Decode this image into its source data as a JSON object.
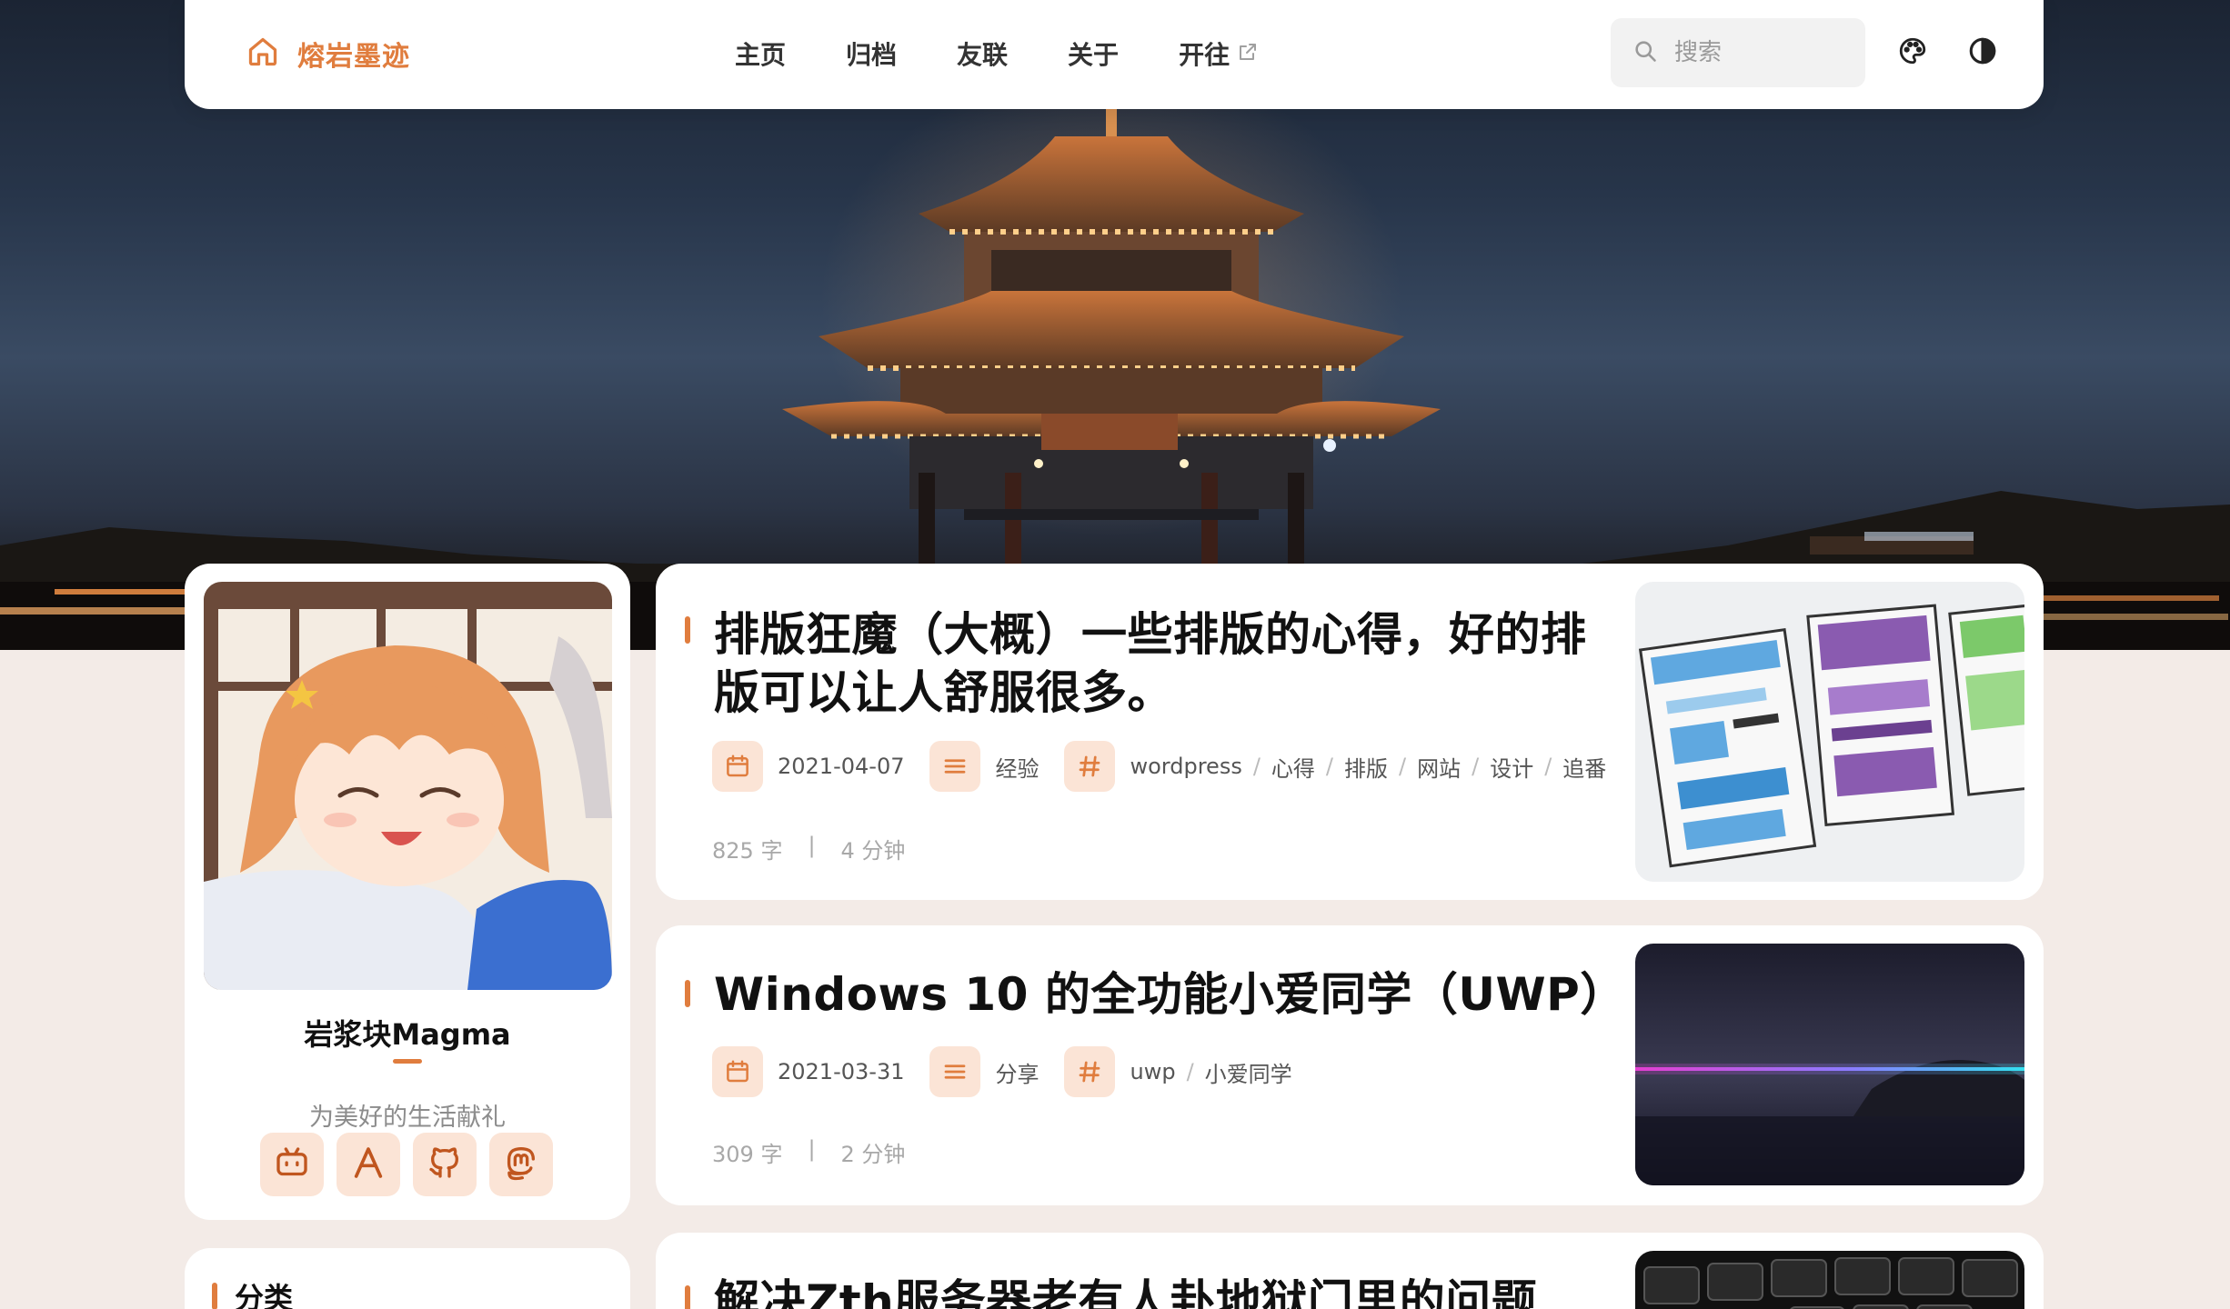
{
  "colors": {
    "accent": "#e07d3e",
    "accent_soft": "#fbe4d6",
    "page_bg": "#f3ebe7"
  },
  "brand": {
    "name": "熔岩墨迹",
    "icon": "home-icon"
  },
  "nav": {
    "items": [
      {
        "label": "主页"
      },
      {
        "label": "归档"
      },
      {
        "label": "友联"
      },
      {
        "label": "关于"
      },
      {
        "label": "开往",
        "icon": "external-link-icon"
      }
    ]
  },
  "search": {
    "placeholder": "搜索",
    "value": ""
  },
  "toolbar": {
    "theme_icon": "palette-icon",
    "mode_icon": "contrast-icon"
  },
  "profile": {
    "name": "岩浆块Magma",
    "motto": "为美好的生活献礼",
    "socials": [
      {
        "icon": "bilibili-icon"
      },
      {
        "icon": "letter-a-icon"
      },
      {
        "icon": "github-icon"
      },
      {
        "icon": "mastodon-icon"
      }
    ]
  },
  "sidebar": {
    "category_title": "分类"
  },
  "posts": [
    {
      "title_line1": "排版狂魔（大概）一些排版的心得，好的排",
      "title_line2": "版可以让人舒服很多。",
      "date": "2021-04-07",
      "category": "经验",
      "tags": [
        "wordpress",
        "心得",
        "排版",
        "网站",
        "设计",
        "追番"
      ],
      "words": "825 字",
      "sep": "|",
      "read_time": "4 分钟"
    },
    {
      "title_line1": "Windows 10 的全功能小爱同学（UWP）",
      "date": "2021-03-31",
      "category": "分享",
      "tags": [
        "uwp",
        "小爱同学"
      ],
      "words": "309 字",
      "sep": "|",
      "read_time": "2 分钟"
    },
    {
      "title_line1": "解决Zth服务器老有人卦地狱门里的问题"
    }
  ]
}
